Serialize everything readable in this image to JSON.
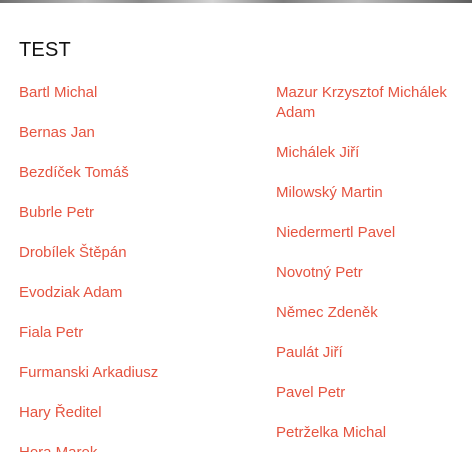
{
  "section": {
    "title": "TEST"
  },
  "names_left": [
    "Bartl Michal",
    "Bernas Jan",
    "Bezdíček Tomáš",
    "Bubrle Petr",
    "Drobílek Štěpán",
    "Evodziak Adam",
    "Fiala Petr",
    "Furmanski Arkadiusz",
    "Hary Ředitel",
    "Hora Marek"
  ],
  "names_right": [
    "Mazur Krzysztof Michálek Adam",
    "Michálek Jiří",
    "Milowský Martin",
    "Niedermertl Pavel",
    "Novotný Petr",
    "Němec Zdeněk",
    "Paulát Jiří",
    "Pavel Petr",
    "Petrželka Michal"
  ],
  "colors": {
    "link": "#e5533f",
    "title": "#111111",
    "background": "#ffffff"
  }
}
